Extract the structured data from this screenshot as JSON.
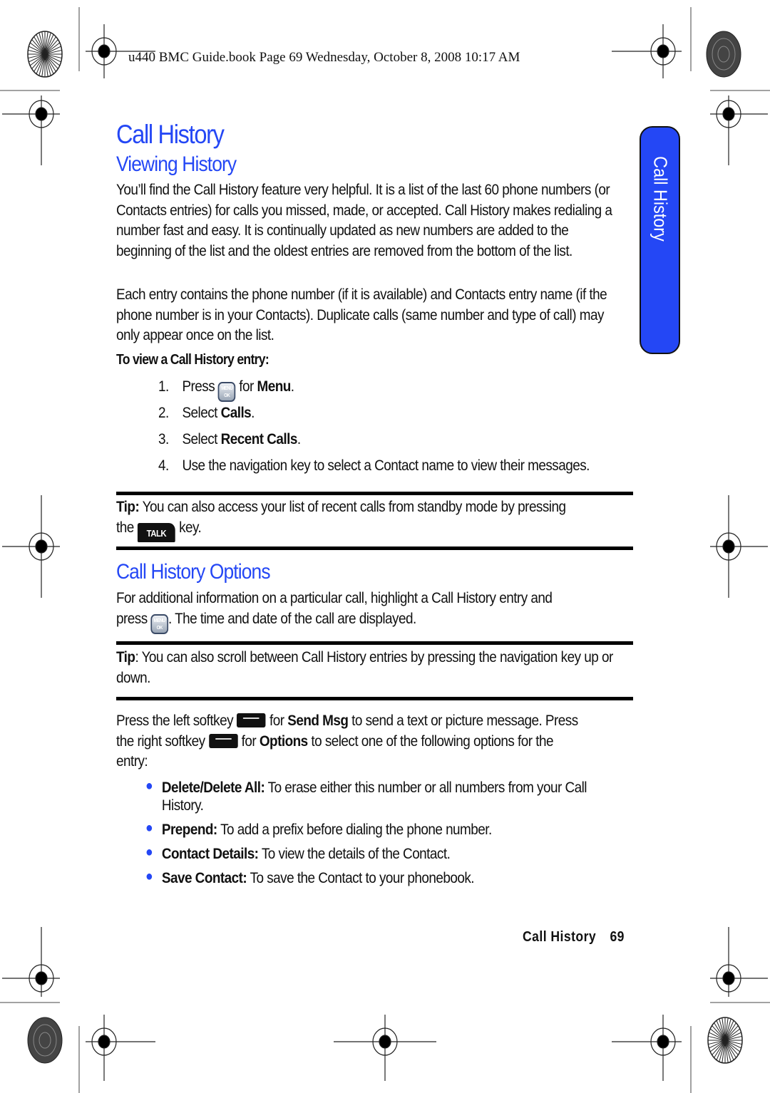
{
  "header": {
    "print_info": "u440 BMC Guide.book  Page 69  Wednesday, October 8, 2008  10:17 AM"
  },
  "side_tab": {
    "label": "Call History",
    "color": "#2447f5"
  },
  "page": {
    "title": "Call History",
    "sections": {
      "viewing": {
        "heading": "Viewing History",
        "paragraphs": [
          "You’ll find the Call History feature very helpful. It is a list of the last 60 phone numbers (or Contacts entries) for calls you missed, made, or accepted. Call History makes redialing a number fast and easy. It is continually updated as new numbers are added to the beginning of the list and the oldest entries are removed from the bottom of the list.",
          "Each entry contains the phone number (if it is available) and Contacts entry name (if the phone number is in your Contacts). Duplicate calls (same number and type of call) may only appear once on the list."
        ],
        "procedure_title": "To view a Call History entry:",
        "steps": [
          {
            "num": "1.",
            "pre": "Press",
            "icon": "menu-ok-key-icon",
            "post": "for",
            "bold": "Menu",
            "end": "."
          },
          {
            "num": "2.",
            "pre": "Select",
            "bold": "Calls",
            "end": "."
          },
          {
            "num": "3.",
            "pre": "Select",
            "bold": "Recent Calls",
            "end": "."
          },
          {
            "num": "4.",
            "pre": "Use the navigation key to select a Contact name to view their messages."
          }
        ],
        "tip": {
          "label": "Tip:",
          "text": "You can also access your list of recent calls from standby mode by pressing",
          "the": "the",
          "key_label": "TALK",
          "after": "key."
        }
      },
      "options": {
        "heading": "Call History Options",
        "intro_1": "For additional information on a particular call, highlight a Call History entry and",
        "intro_press": "press",
        "intro_2": ". The time and date of the call are displayed.",
        "tip": {
          "label": "Tip",
          "text": ": You can also scroll between Call History entries by pressing the navigation key up or down."
        },
        "softkey_text": {
          "a": "Press  the left softkey",
          "b": "for",
          "send_msg": "Send Msg",
          "c": "to send a text or picture message. Press",
          "d": "the right softkey",
          "e": "for",
          "options": "Options",
          "f": "to select one of the following options for the",
          "g": "entry:"
        },
        "bullets": [
          {
            "term": "Delete/Delete All:",
            "desc": "To erase either this number or all numbers from your Call History."
          },
          {
            "term": "Prepend:",
            "desc": "To add a prefix before dialing the phone number."
          },
          {
            "term": "Contact Details:",
            "desc": "To view the details of the Contact."
          },
          {
            "term": "Save Contact:",
            "desc": "To save the Contact to your phonebook."
          }
        ]
      }
    }
  },
  "footer": {
    "section": "Call History",
    "page_number": "69"
  },
  "keys": {
    "menu_top": "MENU",
    "menu_bottom": "OK"
  }
}
